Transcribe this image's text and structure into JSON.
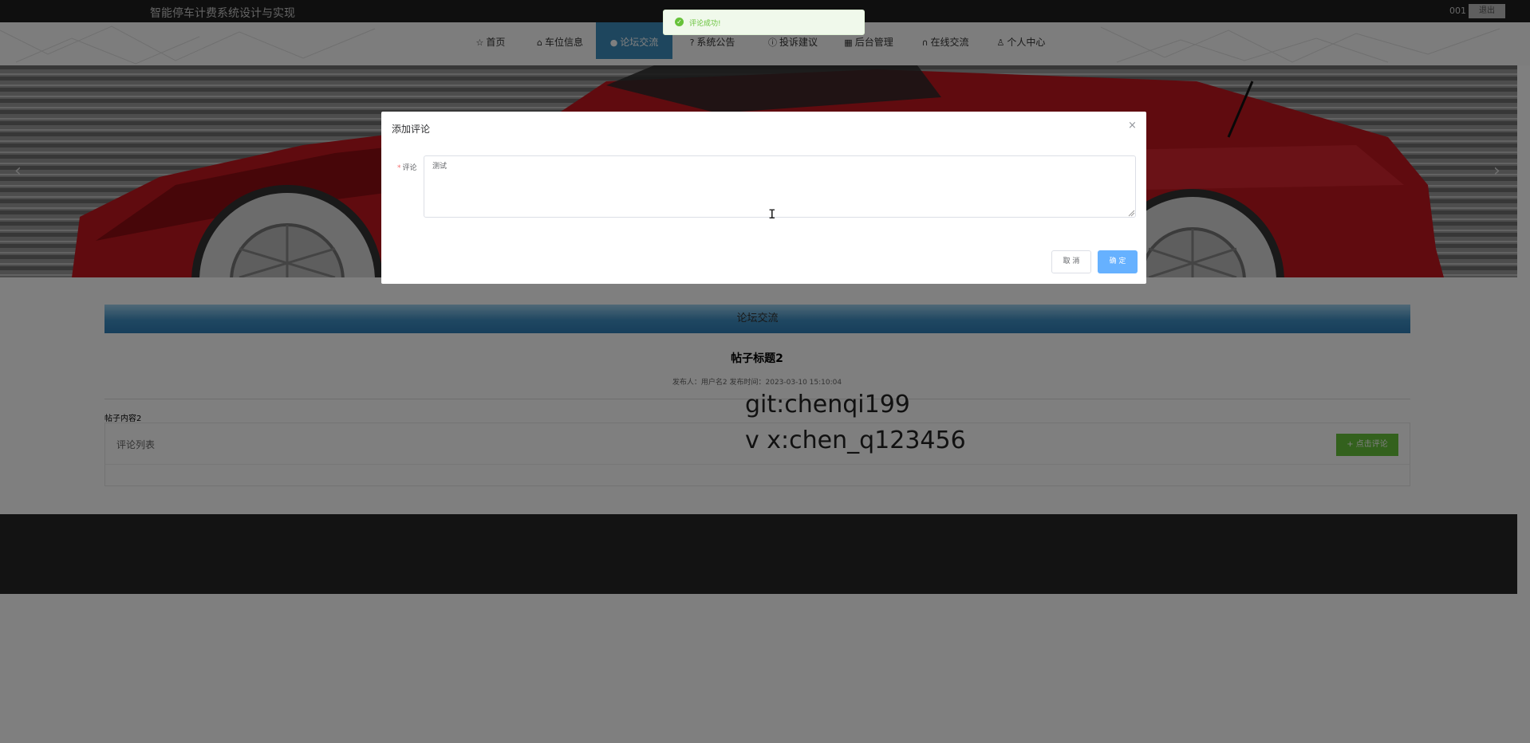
{
  "header": {
    "app_title": "智能停车计费系统设计与实现",
    "user": "001",
    "logout_label": "退出"
  },
  "nav": {
    "items": [
      {
        "icon": "star-icon",
        "glyph": "☆",
        "label": "首页"
      },
      {
        "icon": "lock-icon",
        "glyph": "🔒",
        "label": "车位信息"
      },
      {
        "icon": "info-icon",
        "glyph": "●",
        "label": "论坛交流",
        "active": true
      },
      {
        "icon": "question-icon",
        "glyph": "❓",
        "label": "系统公告"
      },
      {
        "icon": "info-circle-icon",
        "glyph": "ⓘ",
        "label": "投诉建议"
      },
      {
        "icon": "calendar-icon",
        "glyph": "▦",
        "label": "后台管理"
      },
      {
        "icon": "headset-icon",
        "glyph": "∩",
        "label": "在线交流"
      },
      {
        "icon": "user-icon",
        "glyph": "♙",
        "label": "个人中心"
      }
    ],
    "active_color": "#3c8dbc"
  },
  "banner": {
    "prev_glyph": "‹",
    "next_glyph": "›"
  },
  "main": {
    "section_title": "论坛交流",
    "post_title": "帖子标题2",
    "post_meta": "发布人：用户名2  发布时间：2023-03-10 15:10:04",
    "post_content": "帖子内容2",
    "comment_list_label": "评论列表",
    "add_comment_label": "+ 点击评论"
  },
  "watermark": {
    "line1": "git:chenqi199",
    "line2": "v x:chen_q123456"
  },
  "toast": {
    "icon": "check-circle-icon",
    "text": "评论成功!"
  },
  "modal": {
    "title": "添加评论",
    "close_glyph": "×",
    "field_label": "评论",
    "required_mark": "*",
    "textarea_value": "测试",
    "cancel_label": "取 消",
    "confirm_label": "确 定"
  },
  "colors": {
    "success": "#67c23a",
    "primary_light": "#66b1ff",
    "footer": "#262626"
  }
}
